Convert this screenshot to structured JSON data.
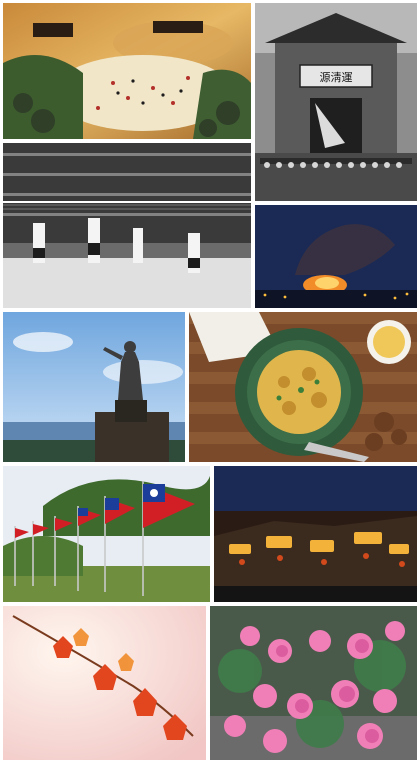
{
  "collage": {
    "tiles": [
      {
        "name": "screen-painting-tile"
      },
      {
        "name": "historic-gate-tile",
        "sign_text": "源淸運"
      },
      {
        "name": "volleyball-match-tile"
      },
      {
        "name": "night-fire-smoke-tile"
      },
      {
        "name": "statue-seaside-tile"
      },
      {
        "name": "pasta-plate-tile"
      },
      {
        "name": "flags-garden-tile"
      },
      {
        "name": "lantern-town-night-tile"
      },
      {
        "name": "maple-leaves-tile"
      },
      {
        "name": "pink-flowers-tile"
      }
    ]
  },
  "colors": {
    "flag_red": "#d21f26",
    "flag_blue": "#1c3d99",
    "night_sky": "#1a2a55",
    "maple_red": "#e2461f"
  }
}
